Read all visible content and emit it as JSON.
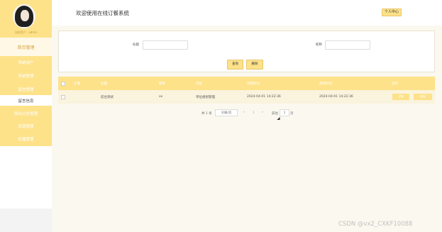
{
  "app": {
    "title": "欢迎使用在线订餐系统",
    "personal_center": "个人中心"
  },
  "sidebar": {
    "user_label": "当前用户：admin",
    "home": "首页管理",
    "items": [
      {
        "label": "系统用户",
        "active": false
      },
      {
        "label": "系统管理",
        "active": false
      },
      {
        "label": "留言管理",
        "active": false
      },
      {
        "label": "留言信息",
        "active": true
      },
      {
        "label": "网站公告管理",
        "active": false
      },
      {
        "label": "资源管理",
        "active": false
      },
      {
        "label": "轮播管理",
        "active": false
      }
    ]
  },
  "search": {
    "title_label": "标题",
    "title_value": "",
    "nickname_label": "昵称",
    "nickname_value": "",
    "query_button": "查询",
    "delete_button": "删除"
  },
  "table": {
    "headers": [
      "头像",
      "标题",
      "昵称",
      "内容",
      "创建时间",
      "更新时间",
      "操作"
    ],
    "rows": [
      {
        "avatar": "",
        "title": "前台测试",
        "nickname": "xx",
        "content": "单位规划管理",
        "created": "2024-04-01 14:22:36",
        "updated": "2024-04-01 14:22:36",
        "edit": "详情",
        "delete": "删除"
      }
    ]
  },
  "pagination": {
    "total": "共 1 条",
    "page_size": "10条/页",
    "prev": "‹",
    "page": "1",
    "next": "›",
    "goto_label": "前往",
    "goto_value": "1",
    "goto_suffix": "页"
  },
  "watermark": "CSDN @vx2_CXKF10088"
}
